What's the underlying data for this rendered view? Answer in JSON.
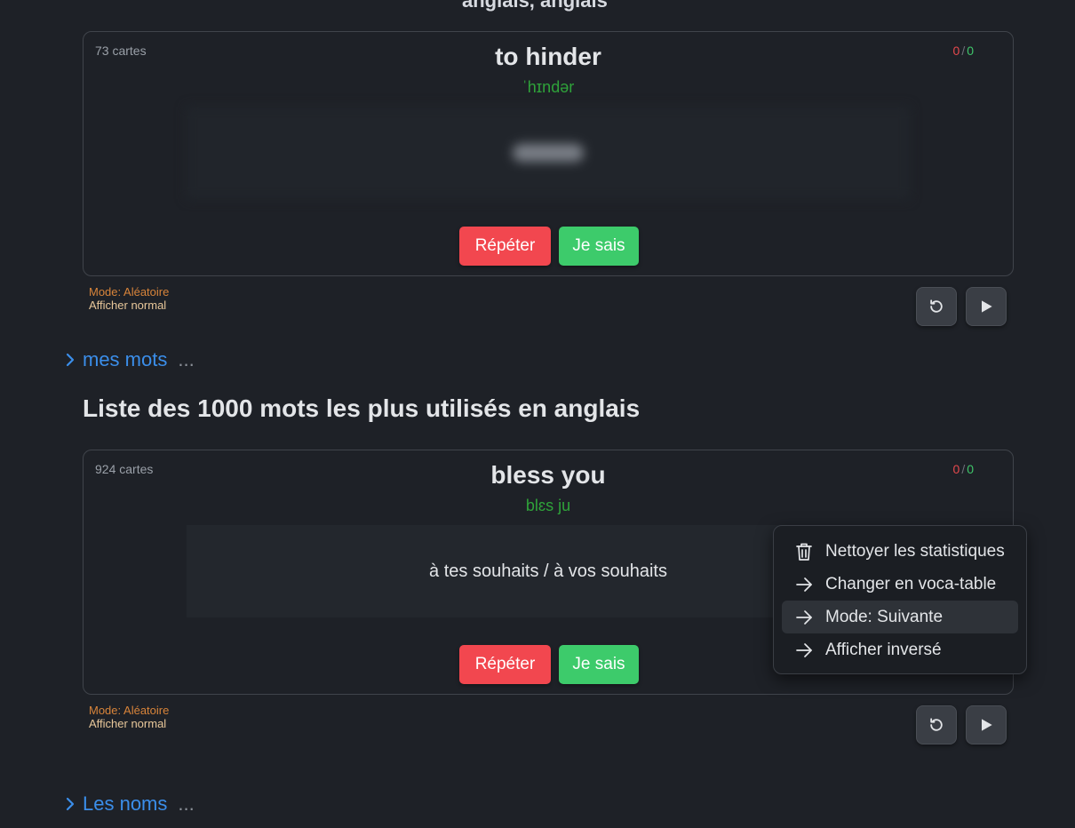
{
  "top_cut_text": "anglais, anglais",
  "cards": [
    {
      "count": "73 cartes",
      "word": "to hinder",
      "phonetic": "ˈhɪndər",
      "translation": "",
      "score_wrong": "0",
      "score_sep": "/",
      "score_right": "0",
      "repeat_label": "Répéter",
      "know_label": "Je sais",
      "mode": "Mode: Aléatoire",
      "display": "Afficher normal"
    },
    {
      "count": "924 cartes",
      "word": "bless you",
      "phonetic": "blɛs ju",
      "translation": "à tes souhaits / à vos souhaits",
      "score_wrong": "0",
      "score_sep": "/",
      "score_right": "0",
      "repeat_label": "Répéter",
      "know_label": "Je sais",
      "mode": "Mode: Aléatoire",
      "display": "Afficher normal"
    }
  ],
  "sections": {
    "mes_mots": {
      "label": "mes mots",
      "ellipsis": "..."
    },
    "les_noms": {
      "label": "Les noms",
      "ellipsis": "..."
    }
  },
  "list_title": "Liste des 1000 mots les plus utilisés en anglais",
  "menu": {
    "items": [
      {
        "label": "Nettoyer les statistiques",
        "icon": "trash-icon"
      },
      {
        "label": "Changer en voca-table",
        "icon": "arrow-right-icon"
      },
      {
        "label": "Mode: Suivante",
        "icon": "arrow-right-icon",
        "active": true
      },
      {
        "label": "Afficher inversé",
        "icon": "arrow-right-icon"
      }
    ]
  },
  "colors": {
    "background": "#1e2127",
    "repeat": "#f2474f",
    "know": "#3dcb6b",
    "link": "#3b8eea",
    "phonetic": "#2fa33a",
    "mode": "#d8843a"
  }
}
